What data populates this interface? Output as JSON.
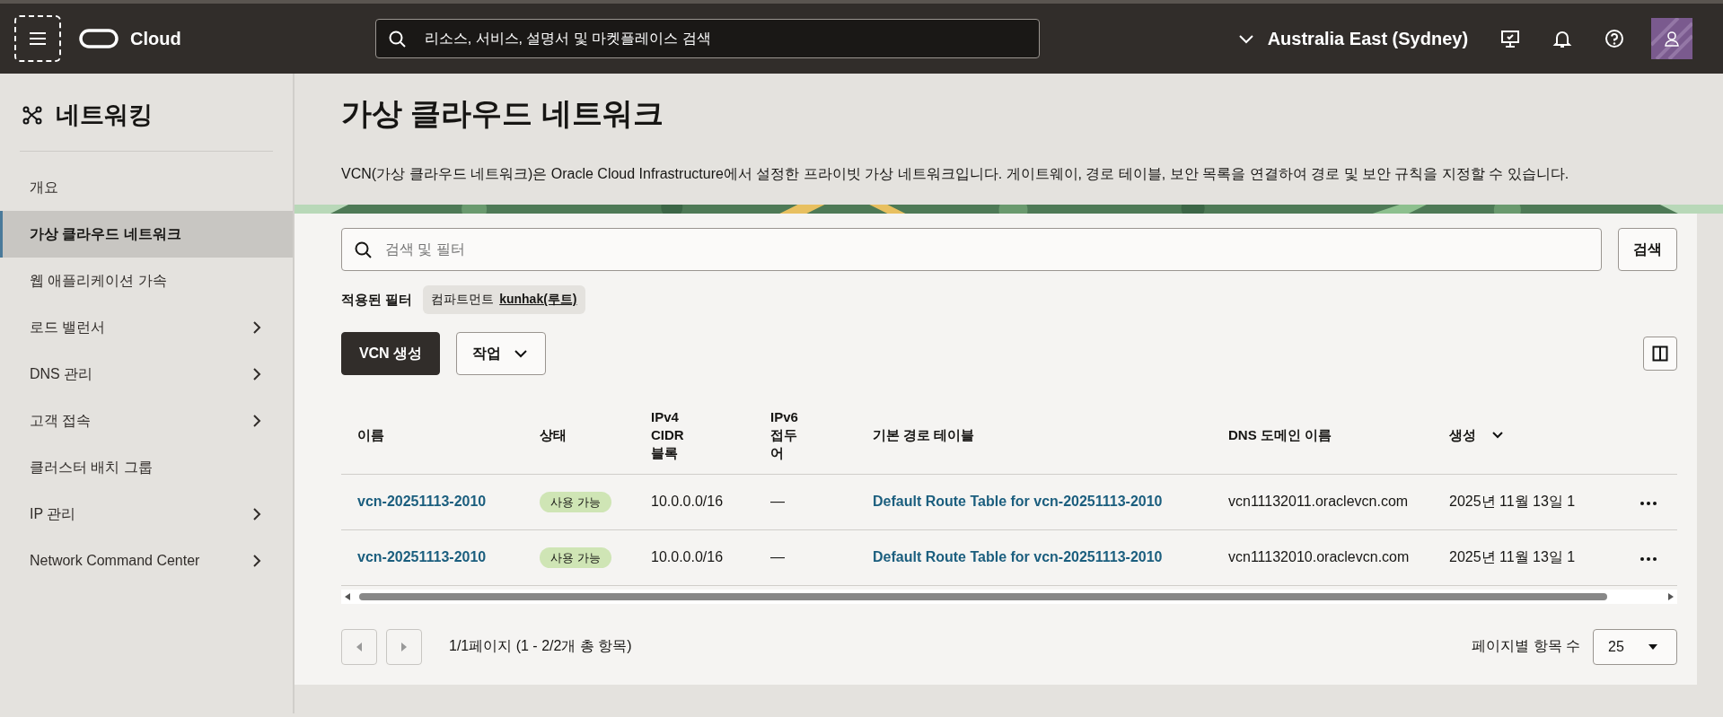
{
  "top_bar": {
    "logo_text": "Cloud",
    "search_placeholder": "리소스, 서비스, 설명서 및 마켓플레이스 검색",
    "region": "Australia East (Sydney)"
  },
  "sidebar": {
    "title": "네트워킹",
    "items": [
      {
        "label": "개요",
        "selected": false,
        "expandable": false
      },
      {
        "label": "가상 클라우드 네트워크",
        "selected": true,
        "expandable": false
      },
      {
        "label": "웹 애플리케이션 가속",
        "selected": false,
        "expandable": false
      },
      {
        "label": "로드 밸런서",
        "selected": false,
        "expandable": true
      },
      {
        "label": "DNS 관리",
        "selected": false,
        "expandable": true
      },
      {
        "label": "고객 접속",
        "selected": false,
        "expandable": true
      },
      {
        "label": "클러스터 배치 그룹",
        "selected": false,
        "expandable": false
      },
      {
        "label": "IP 관리",
        "selected": false,
        "expandable": true
      },
      {
        "label": "Network Command Center",
        "selected": false,
        "expandable": true
      }
    ]
  },
  "page": {
    "title": "가상 클라우드 네트워크",
    "description": "VCN(가상 클라우드 네트워크)은 Oracle Cloud Infrastructure에서 설정한 프라이빗 가상 네트워크입니다. 게이트웨이, 경로 테이블, 보안 목록을 연결하여 경로 및 보안 규칙을 지정할 수 있습니다."
  },
  "filter": {
    "search_placeholder": "검색 및 필터",
    "search_button": "검색",
    "applied_label": "적용된 필터",
    "chip_label": "컴파트먼트",
    "chip_value": "kunhak(루트)"
  },
  "actions": {
    "create_button": "VCN 생성",
    "actions_button": "작업"
  },
  "table": {
    "columns": [
      {
        "label": "이름",
        "sorted": false
      },
      {
        "label": "상태",
        "sorted": false
      },
      {
        "label": "IPv4 CIDR 블록",
        "sorted": false
      },
      {
        "label": "IPv6 접두어",
        "sorted": false
      },
      {
        "label": "기본 경로 테이블",
        "sorted": false
      },
      {
        "label": "DNS 도메인 이름",
        "sorted": false
      },
      {
        "label": "생성",
        "sorted": true
      }
    ],
    "rows": [
      {
        "name": "vcn-20251113-2010",
        "state": "사용 가능",
        "ipv4": "10.0.0.0/16",
        "ipv6": "—",
        "route_table": "Default Route Table for vcn-20251113-2010",
        "dns": "vcn11132011.oraclevcn.com",
        "created": "2025년 11월 13일 1"
      },
      {
        "name": "vcn-20251113-2010",
        "state": "사용 가능",
        "ipv4": "10.0.0.0/16",
        "ipv6": "—",
        "route_table": "Default Route Table for vcn-20251113-2010",
        "dns": "vcn11132010.oraclevcn.com",
        "created": "2025년 11월 13일 1"
      }
    ]
  },
  "pagination": {
    "summary": "1/1페이지 (1 - 2/2개 총 항목)",
    "per_page_label": "페이지별 항목 수",
    "per_page": "25"
  }
}
